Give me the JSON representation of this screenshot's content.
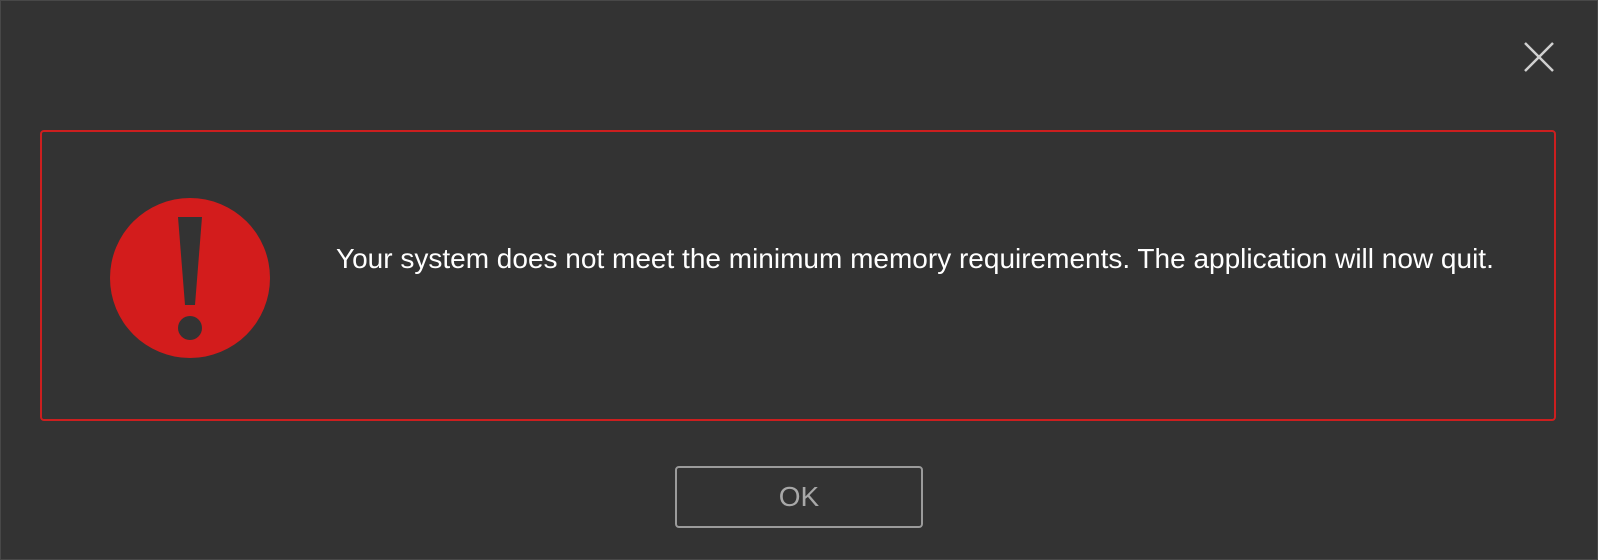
{
  "dialog": {
    "message": "Your system does not meet the minimum memory requirements. The application will now quit.",
    "ok_label": "OK",
    "icons": {
      "close": "close-icon",
      "error": "error-exclamation-icon"
    },
    "colors": {
      "background": "#333333",
      "accent_error": "#d31c1c",
      "text": "#ffffff",
      "button_border": "#9b9b9b",
      "button_text": "#a8a8a8"
    }
  }
}
